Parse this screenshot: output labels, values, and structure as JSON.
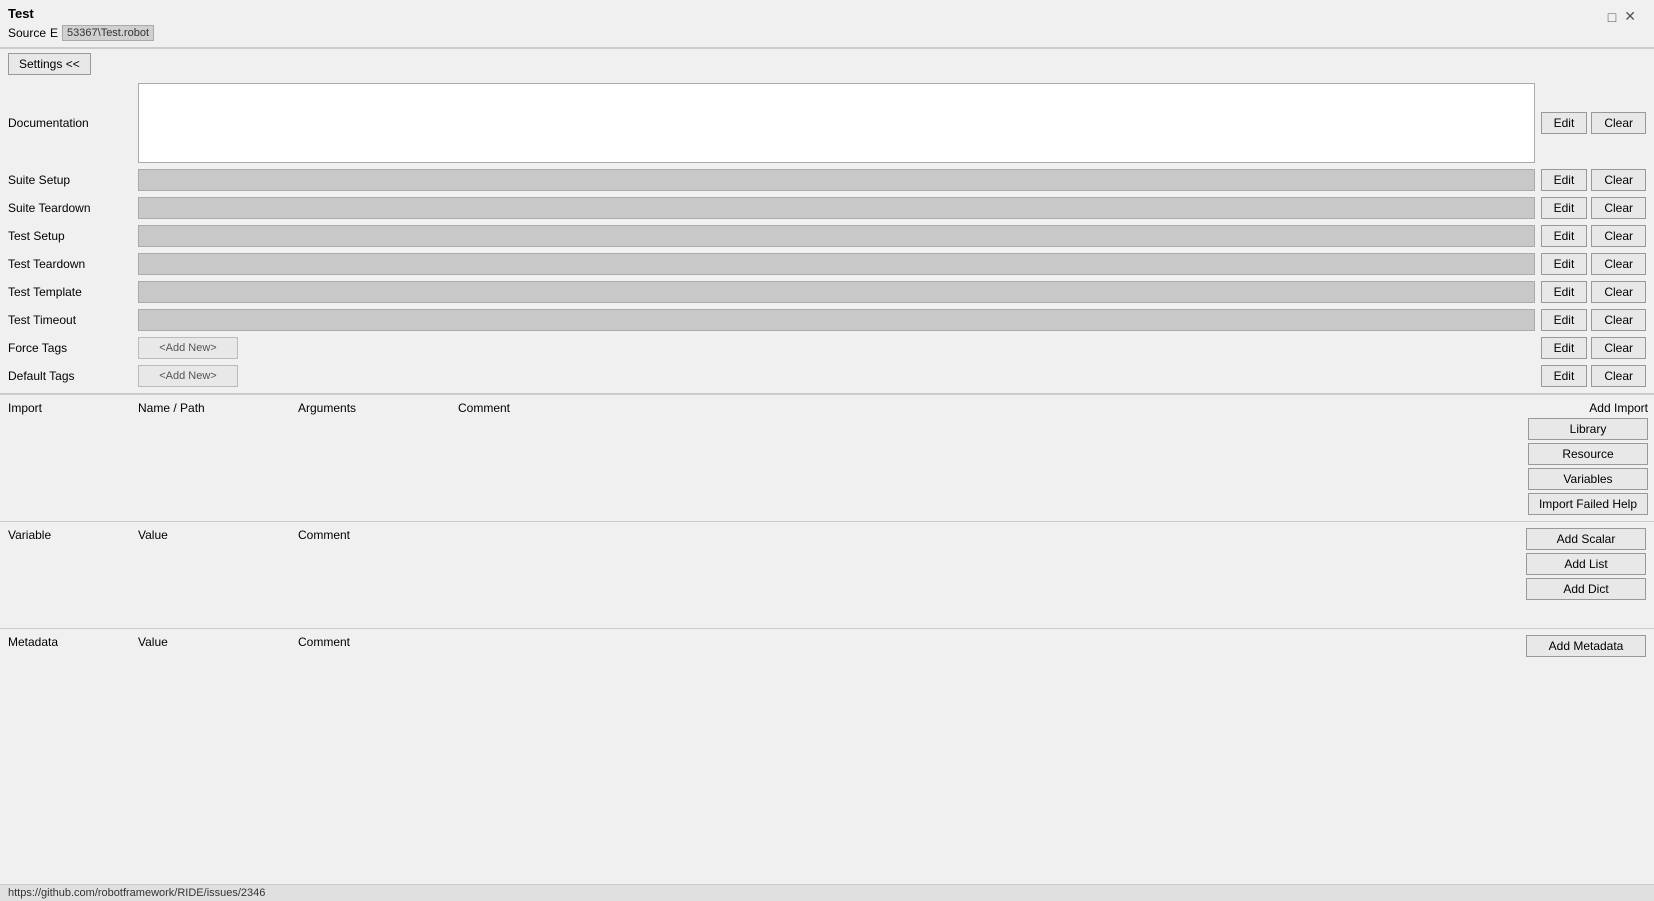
{
  "page": {
    "title": "Test",
    "source_label": "Source",
    "source_prefix": "E",
    "source_path": "53367\\Test.robot",
    "corner_close": "✕",
    "corner_maximize": "□"
  },
  "settings_button": {
    "label": "Settings <<"
  },
  "fields": {
    "documentation_label": "Documentation",
    "suite_setup_label": "Suite Setup",
    "suite_teardown_label": "Suite Teardown",
    "test_setup_label": "Test Setup",
    "test_teardown_label": "Test Teardown",
    "test_template_label": "Test Template",
    "test_timeout_label": "Test Timeout",
    "force_tags_label": "Force Tags",
    "default_tags_label": "Default Tags"
  },
  "buttons": {
    "edit": "Edit",
    "clear": "Clear",
    "add_new": "<Add New>"
  },
  "import_section": {
    "label": "Import",
    "col_name": "Name / Path",
    "col_arguments": "Arguments",
    "col_comment": "Comment",
    "add_import_label": "Add Import",
    "btn_library": "Library",
    "btn_resource": "Resource",
    "btn_variables": "Variables",
    "btn_import_failed": "Import Failed Help"
  },
  "variable_section": {
    "label": "Variable",
    "col_value": "Value",
    "col_comment": "Comment",
    "btn_add_scalar": "Add Scalar",
    "btn_add_list": "Add List",
    "btn_add_dict": "Add Dict"
  },
  "metadata_section": {
    "label": "Metadata",
    "col_value": "Value",
    "col_comment": "Comment",
    "btn_add_metadata": "Add Metadata"
  },
  "status_bar": {
    "text": "https://github.com/robotframework/RIDE/issues/2346"
  }
}
